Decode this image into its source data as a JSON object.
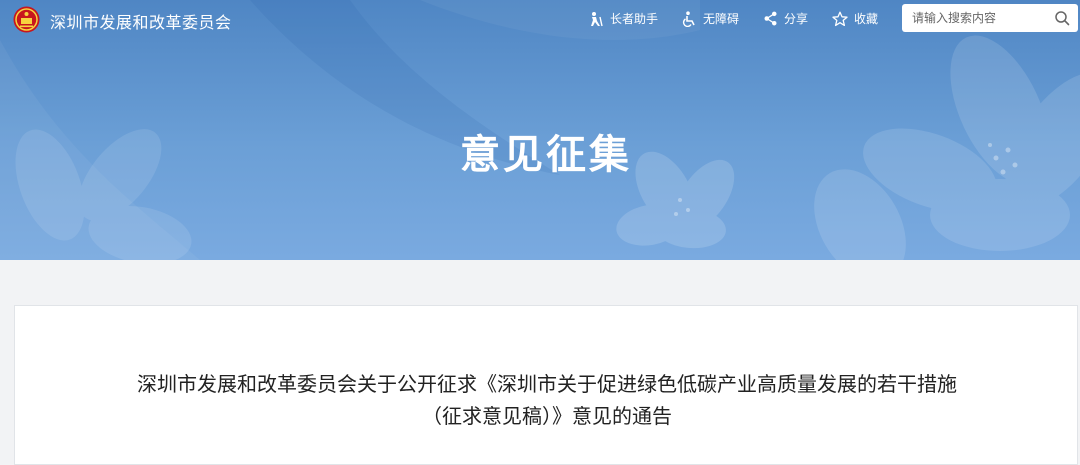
{
  "header": {
    "site_name": "深圳市发展和改革委员会",
    "tools": [
      {
        "label": "长者助手",
        "icon": "elder-assistant-icon"
      },
      {
        "label": "无障碍",
        "icon": "accessibility-icon"
      },
      {
        "label": "分享",
        "icon": "share-icon"
      },
      {
        "label": "收藏",
        "icon": "star-icon"
      }
    ],
    "search": {
      "placeholder": "请输入搜索内容",
      "icon": "search-icon"
    }
  },
  "banner": {
    "title": "意见征集"
  },
  "article": {
    "title_line1": "深圳市发展和改革委员会关于公开征求《深圳市关于促进绿色低碳产业高质量发展的若干措施",
    "title_line2": "（征求意见稿）》意见的通告"
  },
  "colors": {
    "banner": "#5b8fcc",
    "page_bg": "#f2f3f5",
    "card_bg": "#ffffff"
  }
}
